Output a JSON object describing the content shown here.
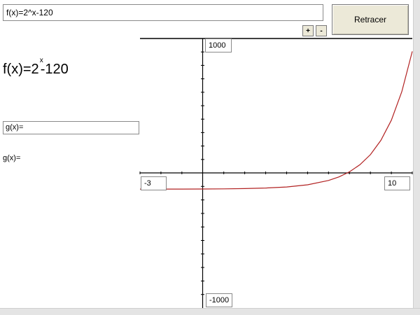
{
  "toolbar": {
    "formula_value": "f(x)=2^x-120",
    "retracer_label": "Retracer",
    "zoom_in_label": "+",
    "zoom_out_label": "-"
  },
  "display": {
    "f_prefix": "f(x)=2",
    "f_exponent": "x",
    "f_suffix": "-120"
  },
  "g_function": {
    "input_value": "g(x)=",
    "label": "g(x)="
  },
  "axes": {
    "ymax": "1000",
    "ymin": "-1000",
    "xmin": "-3",
    "xmax": "10"
  },
  "chart_data": {
    "type": "line",
    "series": [
      {
        "x": [
          -3,
          -2,
          -1,
          0,
          1,
          2,
          3,
          4,
          5,
          6,
          6.5,
          7,
          7.5,
          8,
          8.5,
          9,
          9.5,
          10
        ],
        "y": [
          -119.875,
          -119.75,
          -119.5,
          -119,
          -118,
          -116,
          -112,
          -104,
          -88,
          -56,
          -29.5,
          8,
          61,
          136,
          242,
          392,
          604,
          904
        ],
        "color": "#b22222"
      }
    ],
    "xlim": [
      -3,
      10
    ],
    "ylim": [
      -1000,
      1000
    ],
    "grid": false
  }
}
